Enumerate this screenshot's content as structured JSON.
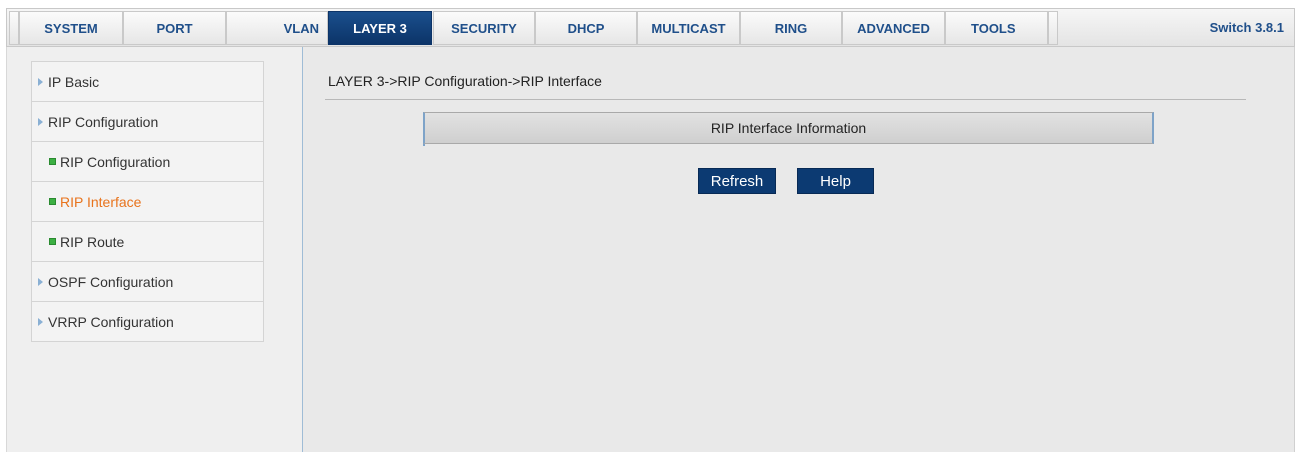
{
  "nav": {
    "tabs": [
      {
        "label": "SYSTEM",
        "active": false
      },
      {
        "label": "PORT",
        "active": false
      },
      {
        "label": "VLAN",
        "active": false
      },
      {
        "label": "LAYER 3",
        "active": true
      },
      {
        "label": "SECURITY",
        "active": false
      },
      {
        "label": "DHCP",
        "active": false
      },
      {
        "label": "MULTICAST",
        "active": false
      },
      {
        "label": "RING",
        "active": false
      },
      {
        "label": "ADVANCED",
        "active": false
      },
      {
        "label": "TOOLS",
        "active": false
      }
    ],
    "version": "Switch 3.8.1"
  },
  "sidebar": {
    "items": [
      {
        "label": "IP Basic",
        "type": "group"
      },
      {
        "label": "RIP Configuration",
        "type": "group"
      },
      {
        "label": "RIP Configuration",
        "type": "sub"
      },
      {
        "label": "RIP Interface",
        "type": "sub",
        "current": true
      },
      {
        "label": "RIP Route",
        "type": "sub"
      },
      {
        "label": "OSPF Configuration",
        "type": "group"
      },
      {
        "label": "VRRP Configuration",
        "type": "group"
      }
    ]
  },
  "main": {
    "breadcrumb": "LAYER 3->RIP Configuration->RIP Interface",
    "section_title": "RIP Interface Information",
    "buttons": {
      "refresh": "Refresh",
      "help": "Help"
    }
  },
  "colors": {
    "active_tab": "#0c3468",
    "tab_text": "#1f4f8a",
    "current_item": "#e8731c",
    "button_bg": "#0c3a72"
  }
}
